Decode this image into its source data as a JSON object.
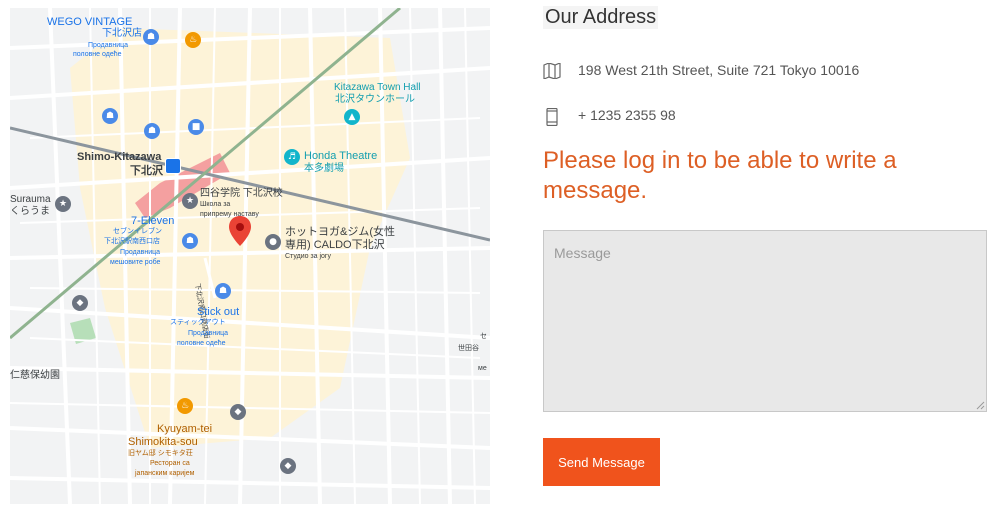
{
  "map": {
    "labels": {
      "wego_en": "WEGO VINTAGE",
      "wego_jp": "下北沢店",
      "wego_sr1": "Продавница",
      "wego_sr2": "половне одеће",
      "kitazawa_en": "Kitazawa Town Hall",
      "kitazawa_jp": "北沢タウンホール",
      "station_en": "Shimo-Kitazawa",
      "station_jp": "下北沢",
      "honda_en": "Honda Theatre",
      "honda_jp": "本多劇場",
      "suzuki_jp": "四谷学院 下北沢校",
      "suzuki_sr1": "Школа за",
      "suzuki_sr2": "припрему наставу",
      "surauma_1": "Surauma",
      "surauma_2": "くらうま",
      "seven_en": "7-Eleven",
      "seven_jp1": "セブンイレブン",
      "seven_jp2": "下北沢駅南西口店",
      "seven_sr1": "Продавница",
      "seven_sr2": "мешовите робе",
      "hotyoga_1": "ホットヨガ&ジム(女性",
      "hotyoga_2": "専用) CALDO下北沢",
      "hotyoga_3": "Студио за јогу",
      "street_jp": "下北沢南口商店街",
      "stick_en": "Stick out",
      "stick_jp": "スティックアウト",
      "stick_sr1": "Продавница",
      "stick_sr2": "половне одеће",
      "park_jp": "仁慈保幼園",
      "kyuyam_1": "Kyuyam-tei",
      "kyuyam_2": "Shimokita-sou",
      "kyuyam_3": "旧ヤム邸 シモキタ荘",
      "kyuyam_4": "Ресторан са",
      "kyuyam_5": "јапанским каријем",
      "edge_1": "セ",
      "edge_2": "世田谷",
      "edge_3": "ме"
    }
  },
  "contact": {
    "title": "Our Address",
    "address": "198 West 21th Street, Suite 721 Tokyo 10016",
    "phone": "+ 1235 2355 98",
    "login_prompt": "Please log in to be able to write a message.",
    "message_placeholder": "Message",
    "send_label": "Send Message"
  },
  "colors": {
    "accent": "#f0531c",
    "prompt": "#dd5f25"
  }
}
